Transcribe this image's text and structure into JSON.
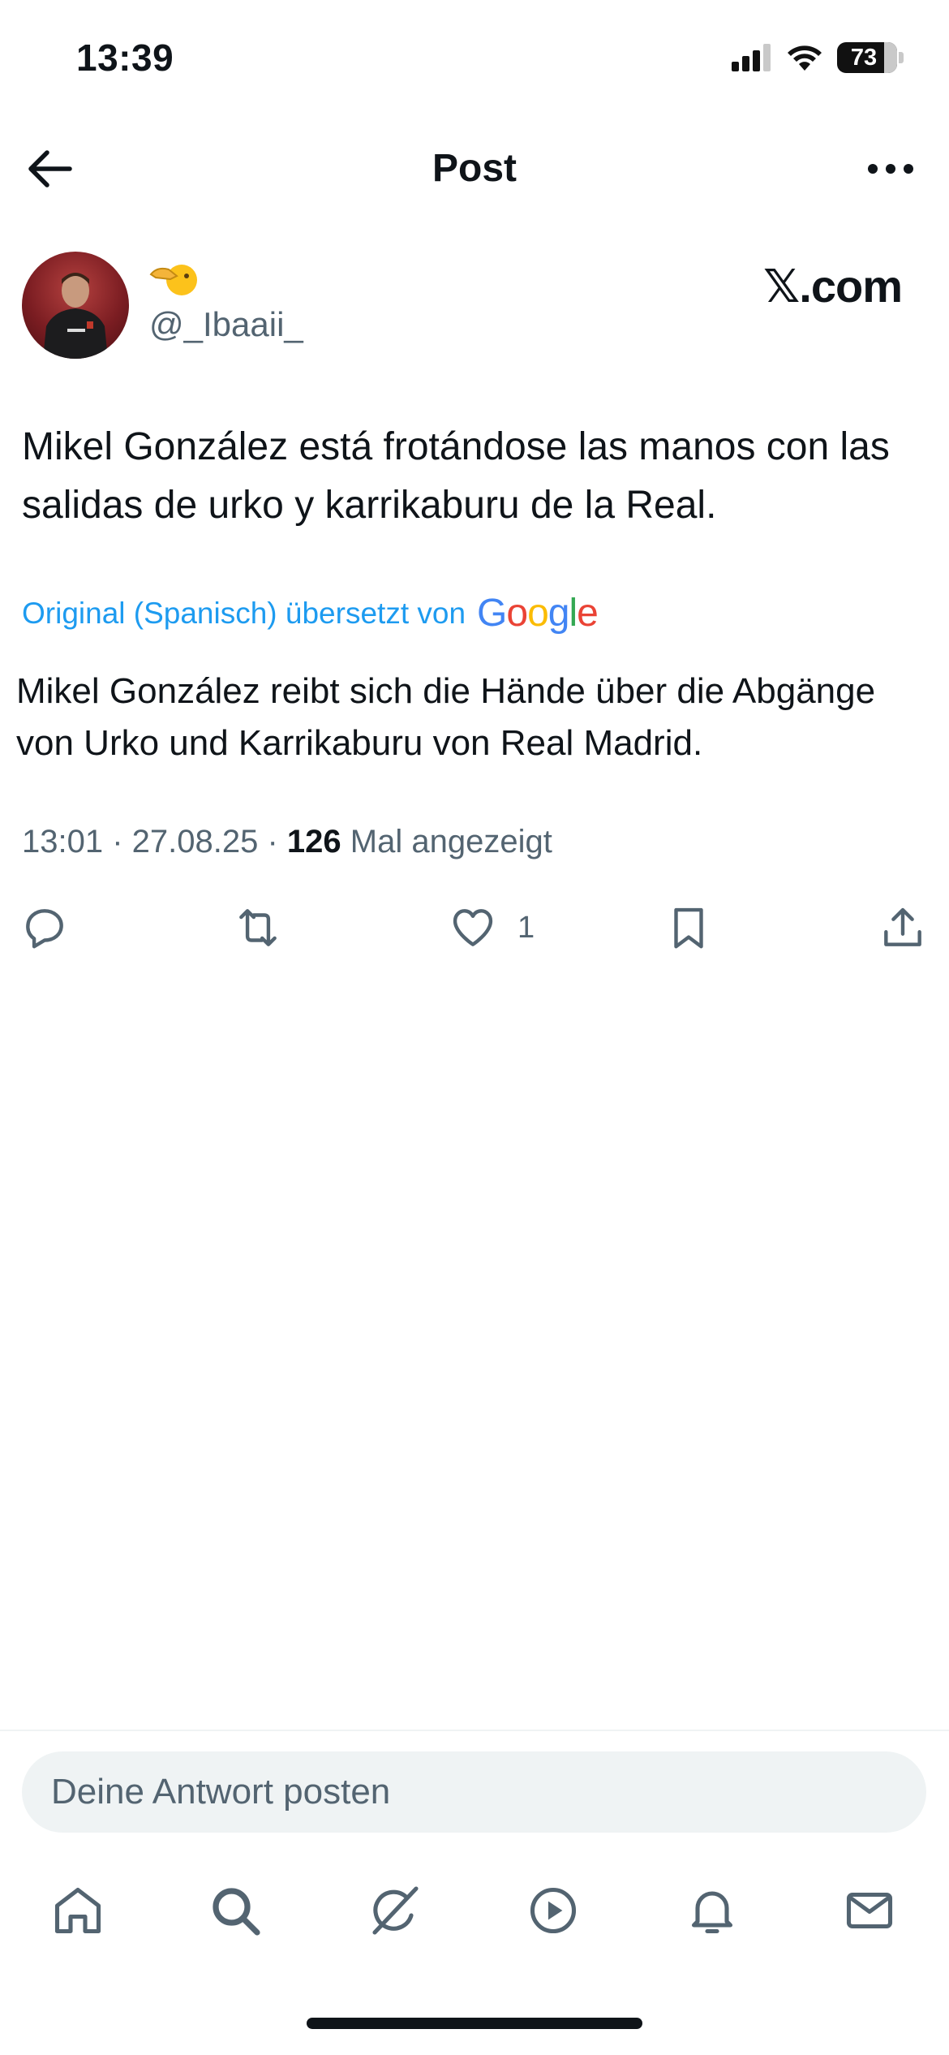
{
  "status_bar": {
    "time": "13:39",
    "battery": "73",
    "icons": [
      "cellular-signal-icon",
      "wifi-icon",
      "battery-icon"
    ]
  },
  "header": {
    "title": "Post",
    "back_icon": "back-arrow-icon",
    "more_icon": "more-options-icon"
  },
  "post": {
    "author": {
      "display_name_emoji": "pointing-emoji",
      "handle": "@_Ibaaii_"
    },
    "source_label": "𝕏.com",
    "text": "Mikel González está frotándose las manos con las salidas de urko y karrikaburu de la Real.",
    "translation": {
      "label": "Original (Spanisch) übersetzt von",
      "provider": "Google",
      "text": "Mikel González reibt sich die Hände über die Abgänge von Urko und Karrikaburu von Real Madrid."
    },
    "meta": {
      "time": "13:01",
      "date": "27.08.25",
      "views_count": "126",
      "views_label": "Mal angezeigt"
    },
    "actions": {
      "reply_icon": "reply-icon",
      "repost_icon": "repost-icon",
      "like_icon": "heart-icon",
      "like_count": "1",
      "bookmark_icon": "bookmark-icon",
      "share_icon": "share-icon"
    }
  },
  "reply": {
    "placeholder": "Deine Antwort posten"
  },
  "tab_bar": {
    "items": [
      "home-icon",
      "search-icon",
      "grok-icon",
      "video-icon",
      "notifications-icon",
      "messages-icon"
    ]
  },
  "colors": {
    "text": "#0f1419",
    "secondary": "#536471",
    "accent": "#1d9bf0",
    "input_bg": "#eff3f4"
  }
}
